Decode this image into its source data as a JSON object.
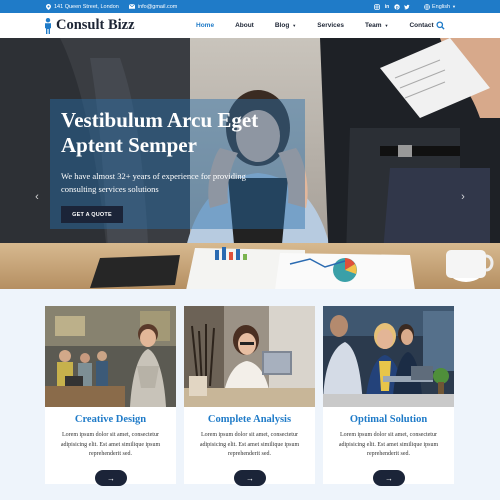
{
  "topbar": {
    "address": "141 Queen Street, London",
    "email": "info@gmail.com",
    "social_icons": [
      "instagram-icon",
      "linkedin-icon",
      "pinterest-icon",
      "twitter-icon"
    ],
    "language": "English"
  },
  "nav": {
    "logo_text": "Consult Bizz",
    "items": [
      {
        "label": "Home",
        "active": true,
        "dropdown": false
      },
      {
        "label": "About",
        "active": false,
        "dropdown": false
      },
      {
        "label": "Blog",
        "active": false,
        "dropdown": true
      },
      {
        "label": "Services",
        "active": false,
        "dropdown": false
      },
      {
        "label": "Team",
        "active": false,
        "dropdown": true
      },
      {
        "label": "Contact",
        "active": false,
        "dropdown": false
      }
    ],
    "search_icon": "search-icon"
  },
  "hero": {
    "title": "Vestibulum Arcu Eget Aptent Semper",
    "subtitle": "We have almost 32+ years of experience for providing consulting services solutions",
    "button_label": "GET A QUOTE"
  },
  "cards": [
    {
      "title": "Creative Design",
      "text": "Lorem ipsum dolor sit amet, consectetur adipisicing elit. Est amet similique ipsum reprehenderit sed.",
      "button": "→"
    },
    {
      "title": "Complete Analysis",
      "text": "Lorem ipsum dolor sit amet, consectetur adipisicing elit. Est amet similique ipsum reprehenderit sed.",
      "button": "→"
    },
    {
      "title": "Optimal Solution",
      "text": "Lorem ipsum dolor sit amet, consectetur adipisicing elit. Est amet similique ipsum reprehenderit sed.",
      "button": "→"
    }
  ],
  "colors": {
    "primary": "#1f7bc8",
    "dark": "#1b2438",
    "background": "#eef4fb"
  }
}
